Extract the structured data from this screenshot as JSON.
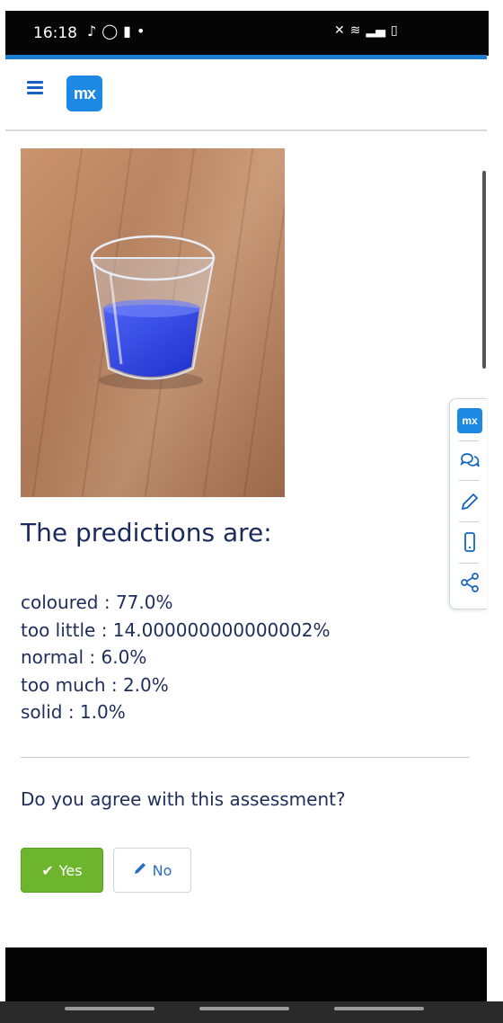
{
  "status_bar": {
    "time": "16:18",
    "left_icons": [
      "tiktok-icon",
      "whatsapp-icon",
      "notification-icon",
      "dot-icon"
    ],
    "right_icons": [
      "mute-icon",
      "wifi-icon",
      "signal-icon",
      "battery-icon"
    ]
  },
  "header": {
    "logo_text": "mx",
    "accent_color": "#1e7fd2",
    "logo_color": "#1e88e5"
  },
  "main": {
    "title": "The predictions are:",
    "predictions": [
      "coloured : 77.0%",
      "too little : 14.000000000000002%",
      "normal : 6.0%",
      "too much : 2.0%",
      "solid : 1.0%"
    ],
    "question": "Do you agree with this assessment?",
    "yes_label": "Yes",
    "no_label": "No",
    "yes_color": "#6cb52d"
  },
  "side_toolbar": {
    "items": [
      "mx-logo-icon",
      "chat-icon",
      "edit-icon",
      "phone-icon",
      "share-icon"
    ],
    "logo_text": "mx"
  }
}
